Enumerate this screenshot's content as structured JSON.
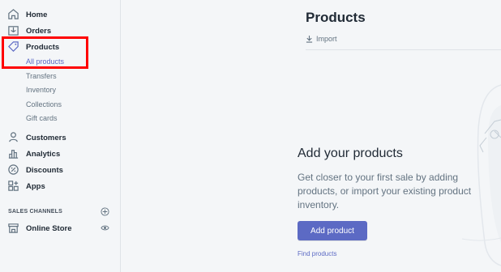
{
  "sidebar": {
    "items": [
      {
        "label": "Home",
        "icon": "home-icon"
      },
      {
        "label": "Orders",
        "icon": "orders-icon"
      },
      {
        "label": "Products",
        "icon": "tag-icon"
      },
      {
        "label": "Customers",
        "icon": "person-icon"
      },
      {
        "label": "Analytics",
        "icon": "bar-chart-icon"
      },
      {
        "label": "Discounts",
        "icon": "discount-icon"
      },
      {
        "label": "Apps",
        "icon": "apps-icon"
      }
    ],
    "product_sub_items": [
      {
        "label": "All products",
        "active": true
      },
      {
        "label": "Transfers"
      },
      {
        "label": "Inventory"
      },
      {
        "label": "Collections"
      },
      {
        "label": "Gift cards"
      }
    ],
    "sales_channels_title": "SALES CHANNELS",
    "channels": [
      {
        "label": "Online Store",
        "icon": "store-icon"
      }
    ]
  },
  "main": {
    "title": "Products",
    "import_label": "Import",
    "empty_state": {
      "heading": "Add your products",
      "description": "Get closer to your first sale by adding products, or import your existing product inventory.",
      "primary_button": "Add product",
      "link": "Find products"
    }
  },
  "colors": {
    "accent": "#5c6ac4",
    "highlight": "#ff0000",
    "background": "#f4f6f8"
  }
}
